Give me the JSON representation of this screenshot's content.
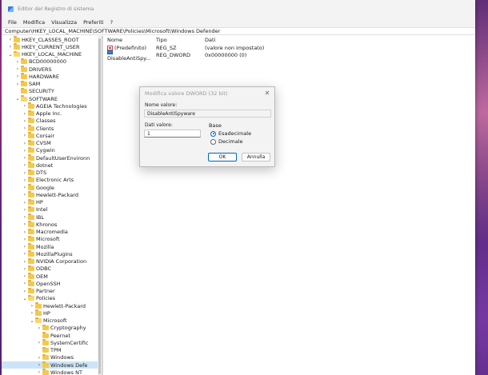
{
  "window": {
    "title": "Editor del Registro di sistema"
  },
  "menu": [
    "File",
    "Modifica",
    "Visualizza",
    "Preferiti",
    "?"
  ],
  "address": "Computer\\HKEY_LOCAL_MACHINE\\SOFTWARE\\Policies\\Microsoft\\Windows Defender",
  "tree": [
    {
      "label": "HKEY_CLASSES_ROOT",
      "depth": 1,
      "chevron": ">"
    },
    {
      "label": "HKEY_CURRENT_USER",
      "depth": 1,
      "chevron": ">"
    },
    {
      "label": "HKEY_LOCAL_MACHINE",
      "depth": 1,
      "chevron": "v"
    },
    {
      "label": "BCD00000000",
      "depth": 2,
      "chevron": ">"
    },
    {
      "label": "DRIVERS",
      "depth": 2,
      "chevron": ">"
    },
    {
      "label": "HARDWARE",
      "depth": 2,
      "chevron": ">"
    },
    {
      "label": "SAM",
      "depth": 2,
      "chevron": ">"
    },
    {
      "label": "SECURITY",
      "depth": 2,
      "chevron": ""
    },
    {
      "label": "SOFTWARE",
      "depth": 2,
      "chevron": "v"
    },
    {
      "label": "AGEIA Technologies",
      "depth": 3,
      "chevron": ">"
    },
    {
      "label": "Apple Inc.",
      "depth": 3,
      "chevron": ">"
    },
    {
      "label": "Classes",
      "depth": 3,
      "chevron": ">"
    },
    {
      "label": "Clients",
      "depth": 3,
      "chevron": ">"
    },
    {
      "label": "Corsair",
      "depth": 3,
      "chevron": ">"
    },
    {
      "label": "CVSM",
      "depth": 3,
      "chevron": ">"
    },
    {
      "label": "Cygwin",
      "depth": 3,
      "chevron": ">"
    },
    {
      "label": "DefaultUserEnvironn",
      "depth": 3,
      "chevron": ">"
    },
    {
      "label": "dotnet",
      "depth": 3,
      "chevron": ">"
    },
    {
      "label": "DTS",
      "depth": 3,
      "chevron": ">"
    },
    {
      "label": "Electronic Arts",
      "depth": 3,
      "chevron": ">"
    },
    {
      "label": "Google",
      "depth": 3,
      "chevron": ">"
    },
    {
      "label": "Hewlett-Packard",
      "depth": 3,
      "chevron": ">"
    },
    {
      "label": "HP",
      "depth": 3,
      "chevron": ">"
    },
    {
      "label": "Intel",
      "depth": 3,
      "chevron": ">"
    },
    {
      "label": "IBL",
      "depth": 3,
      "chevron": ">"
    },
    {
      "label": "Khronos",
      "depth": 3,
      "chevron": ">"
    },
    {
      "label": "Macromedia",
      "depth": 3,
      "chevron": ">"
    },
    {
      "label": "Microsoft",
      "depth": 3,
      "chevron": ">"
    },
    {
      "label": "Mozilla",
      "depth": 3,
      "chevron": ">"
    },
    {
      "label": "MozillaPlugins",
      "depth": 3,
      "chevron": ">"
    },
    {
      "label": "NVIDIA Corporation",
      "depth": 3,
      "chevron": ">"
    },
    {
      "label": "ODBC",
      "depth": 3,
      "chevron": ">"
    },
    {
      "label": "OEM",
      "depth": 3,
      "chevron": ">"
    },
    {
      "label": "OpenSSH",
      "depth": 3,
      "chevron": ">"
    },
    {
      "label": "Partner",
      "depth": 3,
      "chevron": ">"
    },
    {
      "label": "Policies",
      "depth": 3,
      "chevron": "v"
    },
    {
      "label": "Hewlett-Packard",
      "depth": 4,
      "chevron": ">"
    },
    {
      "label": "HP",
      "depth": 4,
      "chevron": ">"
    },
    {
      "label": "Microsoft",
      "depth": 4,
      "chevron": "v"
    },
    {
      "label": "Cryptography",
      "depth": 5,
      "chevron": ">"
    },
    {
      "label": "Peernet",
      "depth": 5,
      "chevron": ""
    },
    {
      "label": "SystemCertific",
      "depth": 5,
      "chevron": ">"
    },
    {
      "label": "TPM",
      "depth": 5,
      "chevron": ""
    },
    {
      "label": "Windows",
      "depth": 5,
      "chevron": ">"
    },
    {
      "label": "Windows Defe",
      "depth": 5,
      "chevron": ">",
      "selected": true
    },
    {
      "label": "Windows NT",
      "depth": 5,
      "chevron": ">"
    }
  ],
  "values_header": {
    "name": "Nome",
    "type": "Tipo",
    "data": "Dati"
  },
  "values": [
    {
      "icon": "string-value-icon",
      "name": "(Predefinito)",
      "type": "REG_SZ",
      "data": "(valore non impostato)"
    },
    {
      "icon": "dword-value-icon",
      "name": "DisableAntiSpy...",
      "type": "REG_DWORD",
      "data": "0x00000000 (0)"
    }
  ],
  "dialog": {
    "title": "Modifica valore DWORD (32 bit)",
    "name_label": "Nome valore:",
    "name_value": "DisableAntiSpyware",
    "data_label": "Dati valore:",
    "data_value": "1",
    "base_label": "Base",
    "hex_label": "Esadecimale",
    "dec_label": "Decimale",
    "ok_label": "OK",
    "cancel_label": "Annulla"
  }
}
